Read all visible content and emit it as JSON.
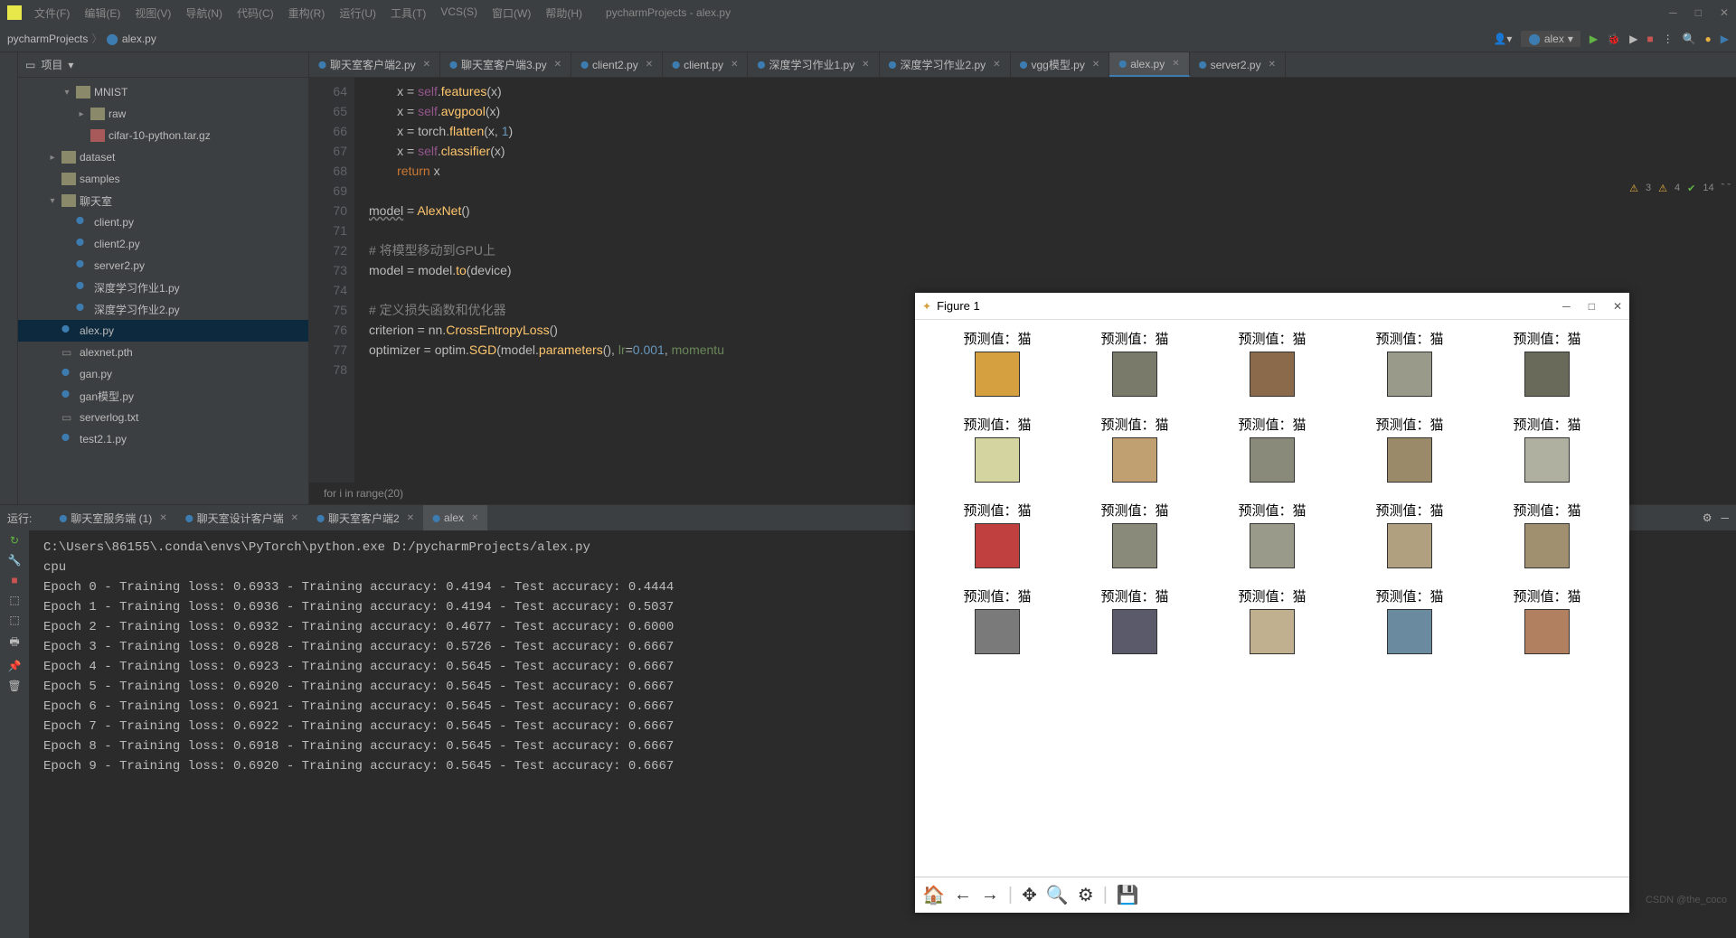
{
  "menu": [
    "文件(F)",
    "编辑(E)",
    "视图(V)",
    "导航(N)",
    "代码(C)",
    "重构(R)",
    "运行(U)",
    "工具(T)",
    "VCS(S)",
    "窗口(W)",
    "帮助(H)"
  ],
  "winTitle": "pycharmProjects - alex.py",
  "breadcrumb": {
    "root": "pycharmProjects",
    "file": "alex.py"
  },
  "runConfig": "alex",
  "sidebar": {
    "title": "项目"
  },
  "tree": [
    {
      "d": 3,
      "e": "▾",
      "t": "folder",
      "n": "MNIST"
    },
    {
      "d": 4,
      "e": "▸",
      "t": "folder",
      "n": "raw"
    },
    {
      "d": 4,
      "e": " ",
      "t": "arc",
      "n": "cifar-10-python.tar.gz"
    },
    {
      "d": 2,
      "e": "▸",
      "t": "folder",
      "n": "dataset"
    },
    {
      "d": 2,
      "e": " ",
      "t": "folder",
      "n": "samples"
    },
    {
      "d": 2,
      "e": "▾",
      "t": "folder",
      "n": "聊天室"
    },
    {
      "d": 3,
      "e": " ",
      "t": "py",
      "n": "client.py"
    },
    {
      "d": 3,
      "e": " ",
      "t": "py",
      "n": "client2.py"
    },
    {
      "d": 3,
      "e": " ",
      "t": "py",
      "n": "server2.py"
    },
    {
      "d": 3,
      "e": " ",
      "t": "py",
      "n": "深度学习作业1.py"
    },
    {
      "d": 3,
      "e": " ",
      "t": "py",
      "n": "深度学习作业2.py"
    },
    {
      "d": 2,
      "e": " ",
      "t": "py",
      "n": "alex.py",
      "sel": true
    },
    {
      "d": 2,
      "e": " ",
      "t": "f",
      "n": "alexnet.pth"
    },
    {
      "d": 2,
      "e": " ",
      "t": "py",
      "n": "gan.py"
    },
    {
      "d": 2,
      "e": " ",
      "t": "py",
      "n": "gan模型.py"
    },
    {
      "d": 2,
      "e": " ",
      "t": "f",
      "n": "serverlog.txt"
    },
    {
      "d": 2,
      "e": " ",
      "t": "py",
      "n": "test2.1.py"
    }
  ],
  "tabs": [
    "聊天室客户端2.py",
    "聊天室客户端3.py",
    "client2.py",
    "client.py",
    "深度学习作业1.py",
    "深度学习作业2.py",
    "vgg模型.py",
    "alex.py",
    "server2.py"
  ],
  "activeTab": 7,
  "lineStart": 64,
  "code": [
    "        x = <self>self</self>.<fn>features</fn>(x)",
    "        x = <self>self</self>.<fn>avgpool</fn>(x)",
    "        x = torch.<fn>flatten</fn>(x, <num>1</num>)",
    "        x = <self>self</self>.<fn>classifier</fn>(x)",
    "        <kw>return</kw> x",
    "",
    "<u>model</u> = <fn>AlexNet</fn>()",
    "",
    "<cmt># 将模型移动到GPU上</cmt>",
    "model = model.<fn>to</fn>(device)",
    "",
    "<cmt># 定义损失函数和优化器</cmt>",
    "criterion = nn.<fn>CrossEntropyLoss</fn>()",
    "optimizer = optim.<fn>SGD</fn>(model.<fn>parameters</fn>(), <str>lr</str>=<num>0.001</num>, <str>momentu</str>",
    ""
  ],
  "codeCrumb": "for i in range(20)",
  "inspections": {
    "warn1": "3",
    "warn2": "4",
    "check": "14"
  },
  "runLabel": "运行:",
  "runTabs": [
    "聊天室服务端 (1)",
    "聊天室设计客户端",
    "聊天室客户端2",
    "alex"
  ],
  "runActive": 3,
  "console": [
    "C:\\Users\\86155\\.conda\\envs\\PyTorch\\python.exe D:/pycharmProjects/alex.py",
    "cpu",
    "Epoch 0 - Training loss: 0.6933 - Training accuracy: 0.4194 - Test accuracy: 0.4444",
    "Epoch 1 - Training loss: 0.6936 - Training accuracy: 0.4194 - Test accuracy: 0.5037",
    "Epoch 2 - Training loss: 0.6932 - Training accuracy: 0.4677 - Test accuracy: 0.6000",
    "Epoch 3 - Training loss: 0.6928 - Training accuracy: 0.5726 - Test accuracy: 0.6667",
    "Epoch 4 - Training loss: 0.6923 - Training accuracy: 0.5645 - Test accuracy: 0.6667",
    "Epoch 5 - Training loss: 0.6920 - Training accuracy: 0.5645 - Test accuracy: 0.6667",
    "Epoch 6 - Training loss: 0.6921 - Training accuracy: 0.5645 - Test accuracy: 0.6667",
    "Epoch 7 - Training loss: 0.6922 - Training accuracy: 0.5645 - Test accuracy: 0.6667",
    "Epoch 8 - Training loss: 0.6918 - Training accuracy: 0.5645 - Test accuracy: 0.6667",
    "Epoch 9 - Training loss: 0.6920 - Training accuracy: 0.5645 - Test accuracy: 0.6667"
  ],
  "figure": {
    "title": "Figure 1",
    "cells": [
      "预测值：猫",
      "预测值：猫",
      "预测值：猫",
      "预测值：猫",
      "预测值：猫",
      "预测值：猫",
      "预测值：猫",
      "预测值：猫",
      "预测值：猫",
      "预测值：猫",
      "预测值：猫",
      "预测值：猫",
      "预测值：猫",
      "预测值：猫",
      "预测值：猫",
      "预测值：猫",
      "预测值：猫",
      "预测值：猫",
      "预测值：猫",
      "预测值：猫"
    ],
    "thumbColors": [
      "#d4a040",
      "#7a7a6a",
      "#8a6a4a",
      "#9a9a8a",
      "#6a6a5a",
      "#d4d4a0",
      "#c0a070",
      "#8a8a7a",
      "#9a8a6a",
      "#b0b0a0",
      "#c04040",
      "#8a8a7a",
      "#9a9a8a",
      "#b0a080",
      "#a09070",
      "#7a7a7a",
      "#5a5a6a",
      "#c0b090",
      "#6a8aa0",
      "#b08060"
    ]
  },
  "watermark": "CSDN @the_coco"
}
